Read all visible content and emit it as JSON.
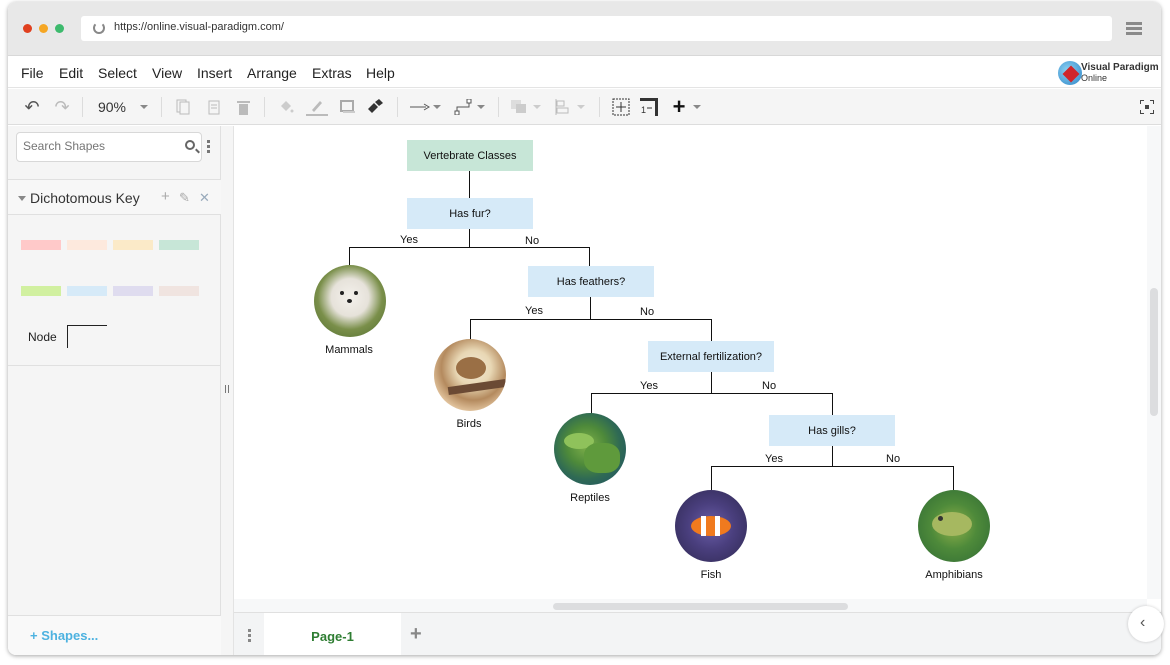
{
  "browser": {
    "url": "https://online.visual-paradigm.com/",
    "dots": [
      "#e0401f",
      "#f5a623",
      "#3dba6d"
    ]
  },
  "menu": {
    "items": [
      "File",
      "Edit",
      "Select",
      "View",
      "Insert",
      "Arrange",
      "Extras",
      "Help"
    ],
    "logo_line1": "Visual Paradigm",
    "logo_line2": "Online"
  },
  "toolbar": {
    "zoom": "90%",
    "undo": "↶",
    "redo": "↷",
    "plus": "+"
  },
  "sidebar": {
    "search_placeholder": "Search Shapes",
    "section_title": "Dichotomous Key",
    "section_actions": [
      "+",
      "✎",
      "✕"
    ],
    "swatches": [
      "#ffc9c9",
      "#fde9dd",
      "#fbeac8",
      "#c7e6d7",
      "#d1f0a0",
      "#d6eaf8",
      "#dfdcef",
      "#f0e4e0"
    ],
    "node_label": "Node",
    "shapes_button": "+ Shapes..."
  },
  "pages": {
    "current": "Page-1",
    "add": "+",
    "collapse": "‹"
  },
  "diagram": {
    "root": "Vertebrate Classes",
    "questions": [
      "Has fur?",
      "Has feathers?",
      "External fertilization?",
      "Has gills?"
    ],
    "yes": "Yes",
    "no": "No",
    "leaves": [
      "Mammals",
      "Birds",
      "Reptiles",
      "Fish",
      "Amphibians"
    ]
  }
}
